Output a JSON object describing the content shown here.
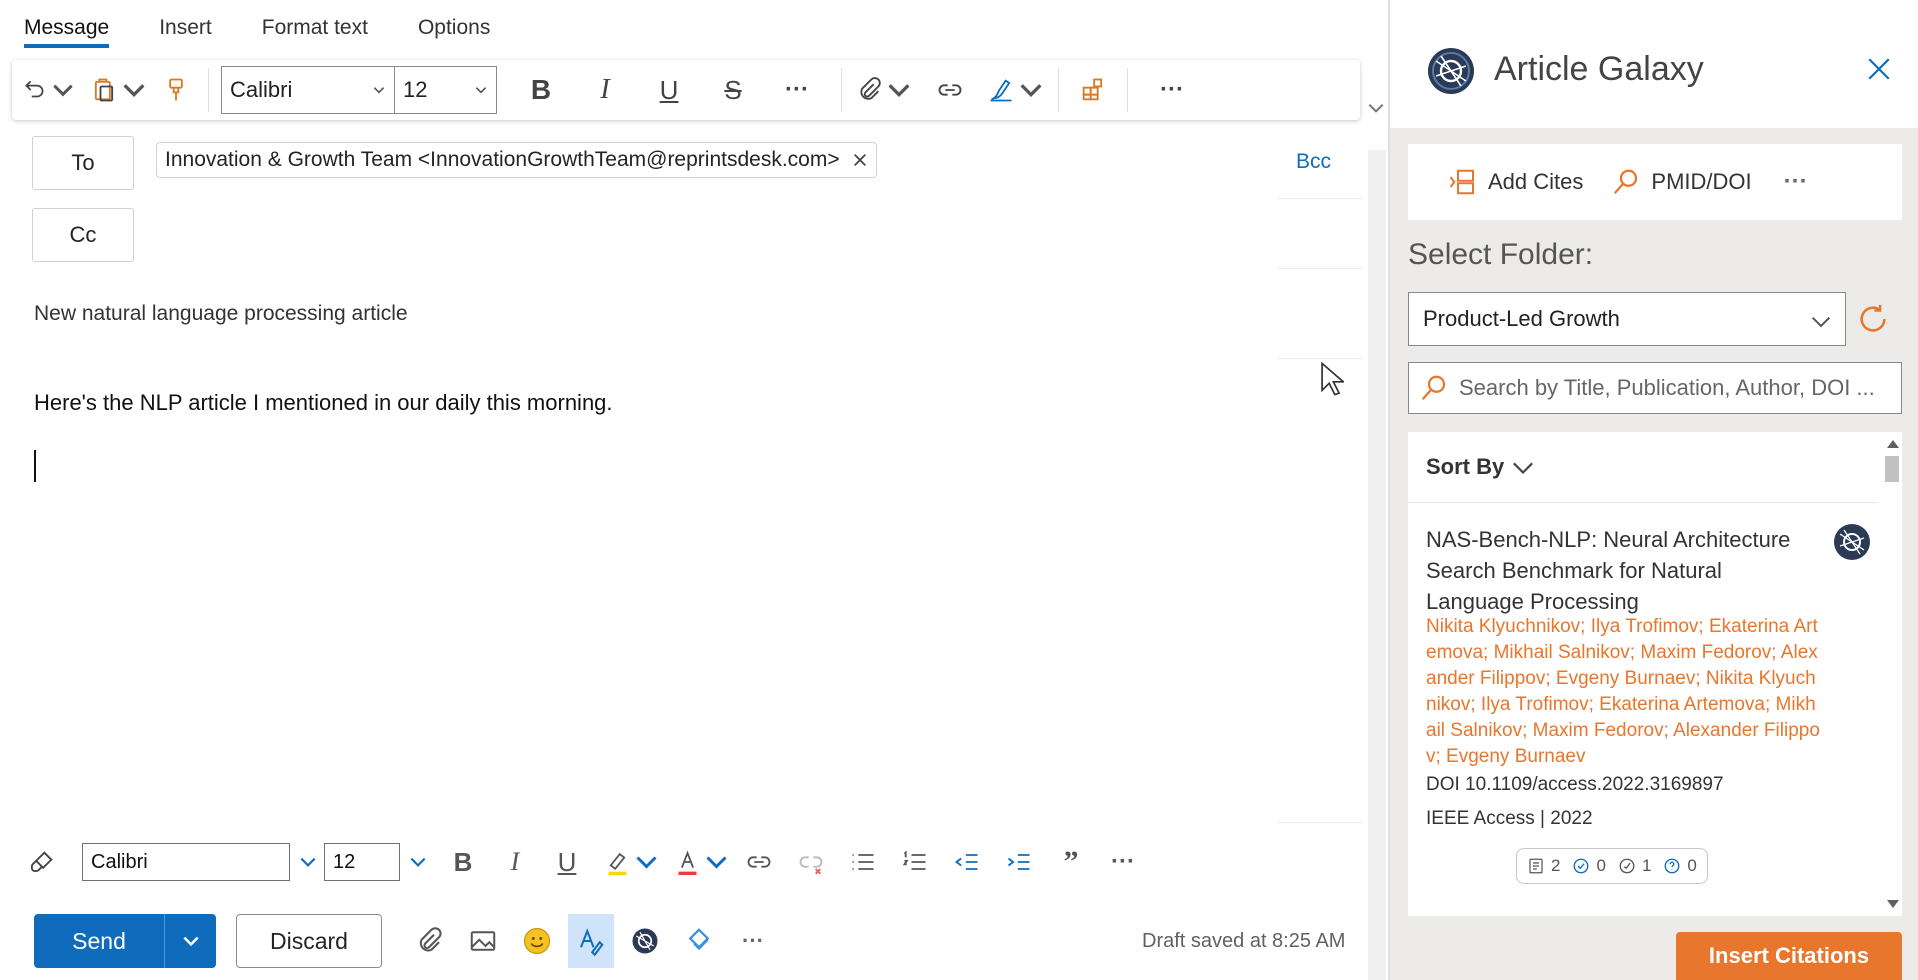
{
  "tabs": [
    {
      "label": "Message",
      "active": true
    },
    {
      "label": "Insert",
      "active": false
    },
    {
      "label": "Format text",
      "active": false
    },
    {
      "label": "Options",
      "active": false
    }
  ],
  "ribbon": {
    "font_name": "Calibri",
    "font_size": "12"
  },
  "recipients": {
    "to_label": "To",
    "cc_label": "Cc",
    "bcc_label": "Bcc",
    "to_chip": "Innovation & Growth Team <InnovationGrowthTeam@reprintsdesk.com>"
  },
  "subject": "New natural language processing article",
  "body": "Here's the NLP article I mentioned in our daily this morning.",
  "format_bar": {
    "font_name": "Calibri",
    "font_size": "12"
  },
  "send_bar": {
    "send_label": "Send",
    "discard_label": "Discard",
    "draft_status": "Draft saved at 8:25 AM"
  },
  "pane": {
    "title": "Article Galaxy",
    "add_cites_label": "Add Cites",
    "pmid_doi_label": "PMID/DOI",
    "select_folder_label": "Select Folder:",
    "folder_selected": "Product-Led Growth",
    "search_placeholder": "Search by Title, Publication, Author, DOI ...",
    "sort_by_label": "Sort By",
    "insert_citations_label": "Insert Citations",
    "article": {
      "title": "NAS-Bench-NLP: Neural Architecture Search Benchmark for Natural Language Processing",
      "authors": "Nikita Klyuchnikov; Ilya Trofimov; Ekaterina Artemova; Mikhail Salnikov; Maxim Fedorov; Alexander Filippov; Evgeny Burnaev; Nikita Klyuchnikov; Ilya Trofimov; Ekaterina Artemova; Mikhail Salnikov; Maxim Fedorov; Alexander Filippov; Evgeny Burnaev",
      "doi": "DOI 10.1109/access.2022.3169897",
      "publication": "IEEE Access | 2022",
      "badges": {
        "notes": "2",
        "check": "0",
        "verified": "1",
        "questions": "0"
      }
    }
  },
  "colors": {
    "accent_blue": "#0f6cbd",
    "accent_orange": "#e8762c"
  }
}
